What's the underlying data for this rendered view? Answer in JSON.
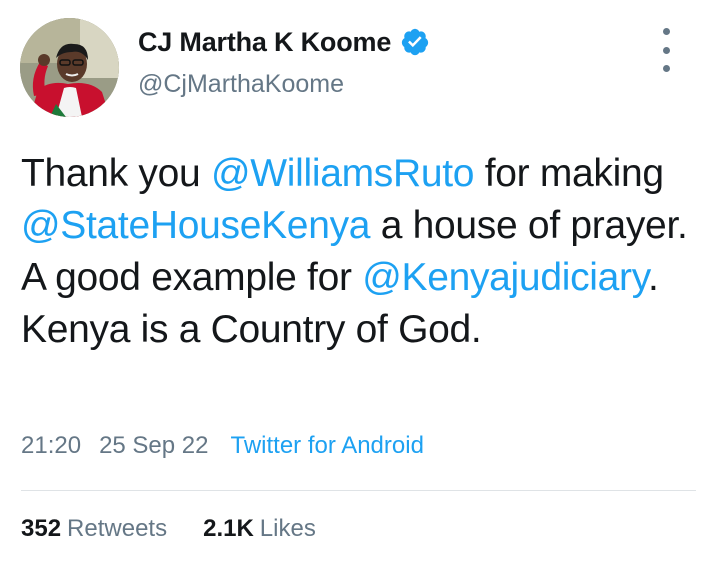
{
  "author": {
    "display_name": "CJ Martha K Koome",
    "handle": "@CjMarthaKoome",
    "verified": true,
    "avatar_icon": "profile-photo"
  },
  "tweet": {
    "segments": [
      {
        "text": "Thank you ",
        "mention": false
      },
      {
        "text": "@WilliamsRuto",
        "mention": true
      },
      {
        "text": " for making ",
        "mention": false
      },
      {
        "text": "@StateHouseKenya",
        "mention": true
      },
      {
        "text": " a house of prayer. A good example for ",
        "mention": false
      },
      {
        "text": "@Kenyajudiciary",
        "mention": true
      },
      {
        "text": ". Kenya is a Country of God.",
        "mention": false
      }
    ],
    "time": "21:20",
    "date": "25 Sep 22",
    "source": "Twitter for Android"
  },
  "stats": {
    "retweets_count": "352",
    "retweets_label": "Retweets",
    "likes_count": "2.1K",
    "likes_label": "Likes"
  },
  "colors": {
    "mention": "#1da1f2",
    "secondary_text": "#657786",
    "primary_text": "#14171a",
    "verified_badge": "#1da1f2"
  }
}
